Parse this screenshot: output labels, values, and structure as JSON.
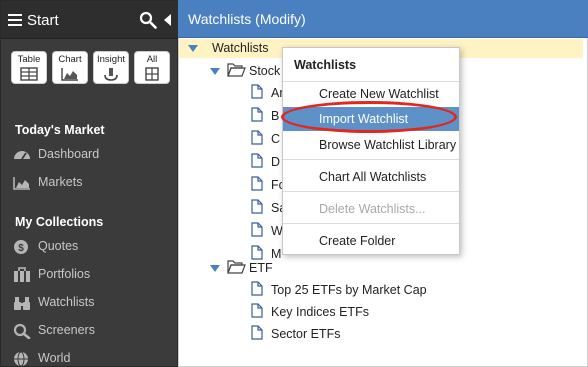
{
  "sidebar": {
    "title": "Start",
    "views": [
      {
        "label": "Table",
        "icon": "table-icon"
      },
      {
        "label": "Chart",
        "icon": "chart-icon"
      },
      {
        "label": "Insight",
        "icon": "insight-icon"
      },
      {
        "label": "All",
        "icon": "all-icon"
      }
    ],
    "sections": [
      {
        "title": "Today's Market",
        "items": [
          {
            "label": "Dashboard",
            "icon": "dashboard-icon"
          },
          {
            "label": "Markets",
            "icon": "markets-icon"
          }
        ]
      },
      {
        "title": "My Collections",
        "items": [
          {
            "label": "Quotes",
            "icon": "quotes-icon"
          },
          {
            "label": "Portfolios",
            "icon": "portfolios-icon"
          },
          {
            "label": "Watchlists",
            "icon": "binoculars-icon"
          },
          {
            "label": "Screeners",
            "icon": "search-icon"
          },
          {
            "label": "World",
            "icon": "globe-icon"
          }
        ]
      }
    ]
  },
  "header": {
    "title": "Watchlists (Modify)"
  },
  "tree": {
    "root": "Watchlists",
    "stocks_folder": "Stock",
    "stock_items": [
      "Ar",
      "B",
      "C",
      "D",
      "Fo",
      "Sa",
      "W",
      "M"
    ],
    "etf_folder": "ETF",
    "etf_items": [
      "Top 25 ETFs by Market Cap",
      "Key Indices ETFs",
      "Sector ETFs"
    ]
  },
  "menu": {
    "title": "Watchlists",
    "items": [
      {
        "label": "Create New Watchlist",
        "state": "normal"
      },
      {
        "label": "Import Watchlist",
        "state": "highlighted"
      },
      {
        "label": "Browse Watchlist Library",
        "state": "normal"
      },
      {
        "label": "Chart All Watchlists",
        "state": "normal"
      },
      {
        "label": "Delete Watchlists...",
        "state": "disabled"
      },
      {
        "label": "Create Folder",
        "state": "normal"
      }
    ]
  },
  "colors": {
    "header_blue": "#4a80c0",
    "sidebar_bg": "#3b3b3b",
    "selected_row": "#fff3c4",
    "menu_highlight": "#5f91c9",
    "annotation_ring": "#e0281f"
  }
}
